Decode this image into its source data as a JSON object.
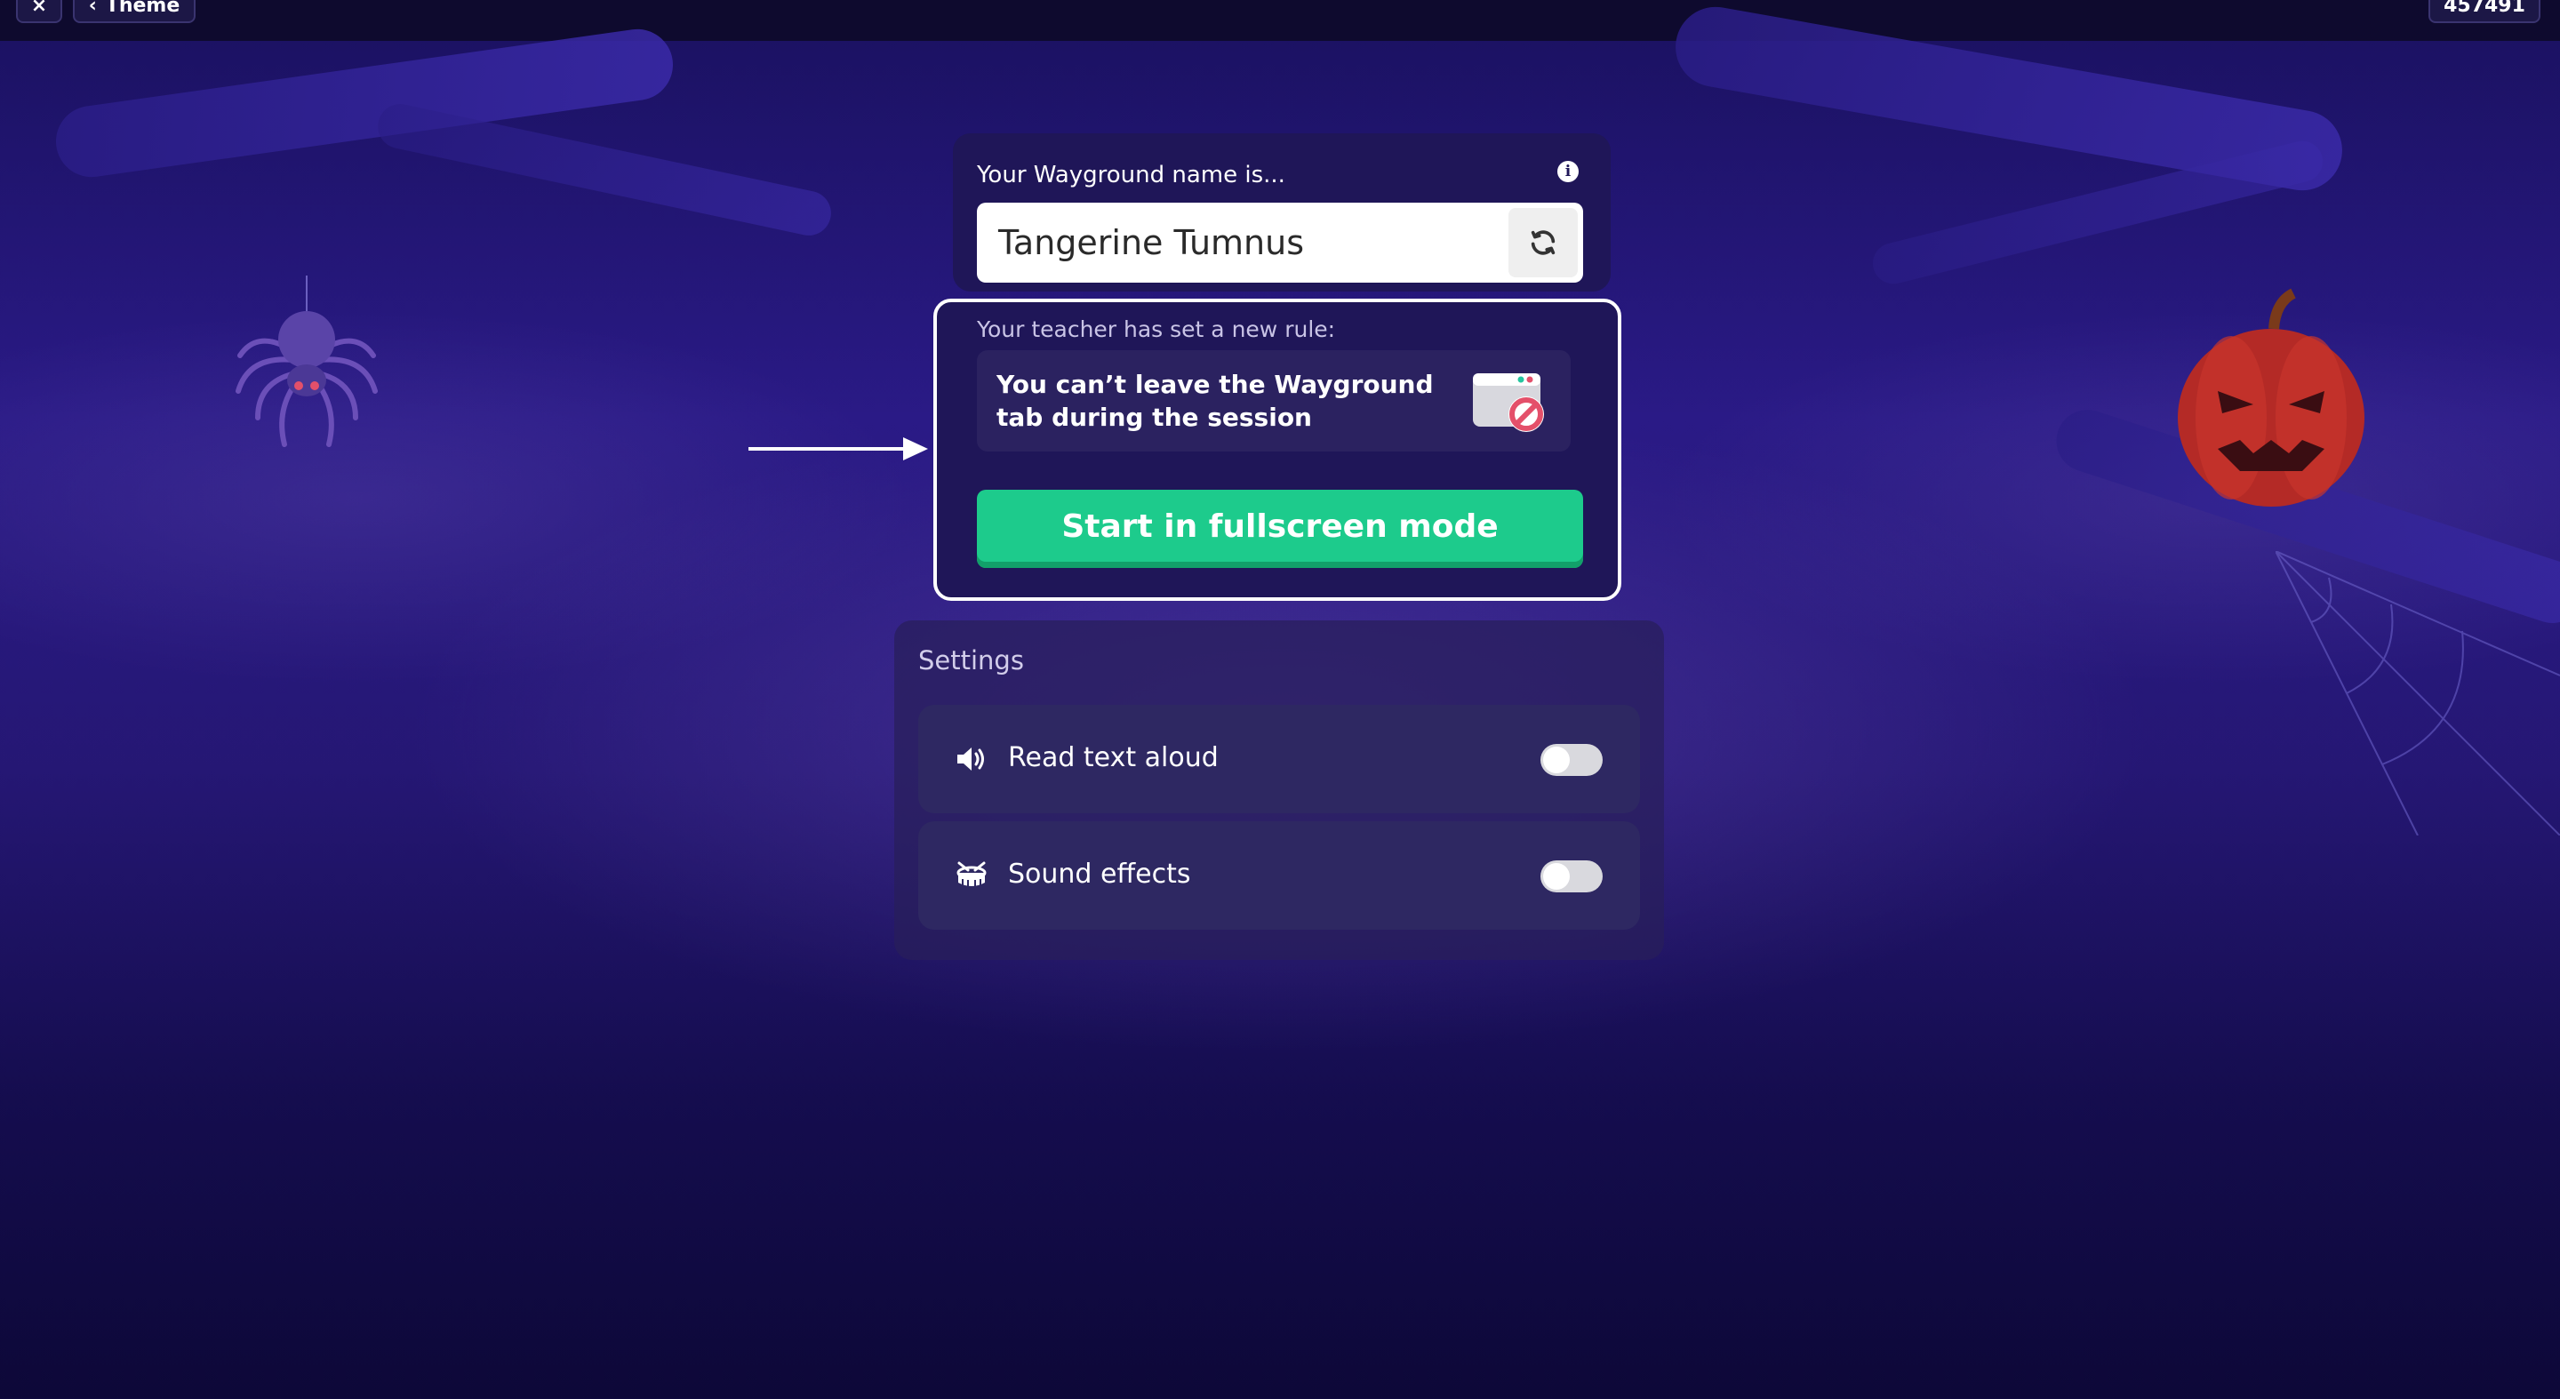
{
  "topbar": {
    "close_label": "×",
    "theme_label": "Theme",
    "count_label": "457491"
  },
  "name_card": {
    "label": "Your Wayground name is...",
    "value": "Tangerine Tumnus",
    "info_icon": "info-icon",
    "refresh_icon": "refresh-icon"
  },
  "rule": {
    "label": "Your teacher has set a new rule:",
    "message": "You can’t leave the Wayground tab during the session",
    "icon": "blocked-tab-icon",
    "start_button": "Start in fullscreen mode"
  },
  "settings": {
    "title": "Settings",
    "items": [
      {
        "label": "Read text aloud",
        "icon": "speaker-icon",
        "enabled": false
      },
      {
        "label": "Sound effects",
        "icon": "drum-icon",
        "enabled": false
      }
    ]
  },
  "colors": {
    "accent_green": "#1dcb8c",
    "card_bg": "#1f1658",
    "toggle_off": "#d9d9de"
  }
}
